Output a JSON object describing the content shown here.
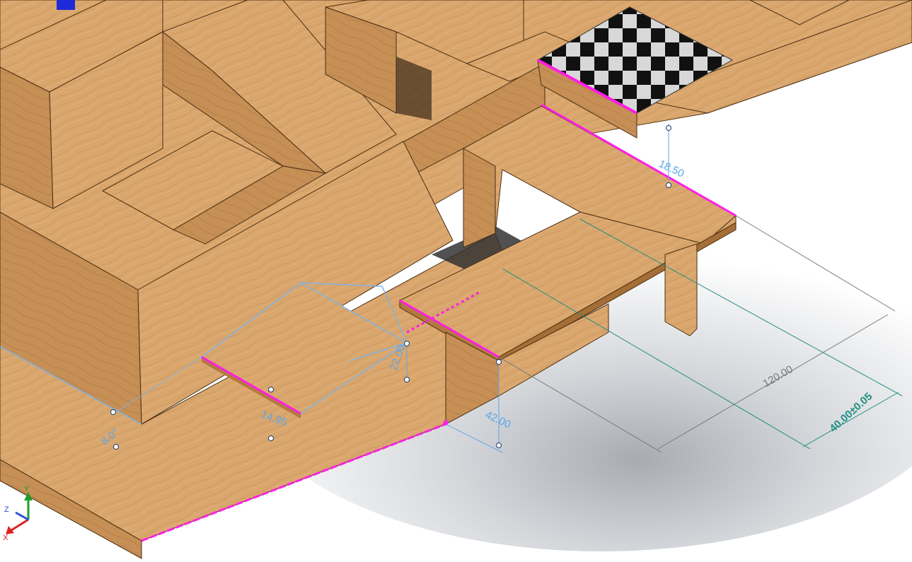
{
  "viewport": {
    "background_colors": {
      "top": "#ffffff",
      "shadow": "#bfc2c6"
    },
    "model": {
      "material": "beech-wood",
      "wood_color": "#d9a66d",
      "wood_dark": "#b88552"
    }
  },
  "dimensions": [
    {
      "id": "dim-18-50",
      "text": "18.50",
      "color": "#5aa5e8"
    },
    {
      "id": "dim-120",
      "text": "120.00",
      "color": "#7a7a7a"
    },
    {
      "id": "dim-40-tol",
      "text": "40.00±0.05",
      "color": "#1f8f84"
    },
    {
      "id": "dim-42",
      "text": "42.00",
      "color": "#5aa5e8"
    },
    {
      "id": "dim-22",
      "text": "22.00",
      "color": "#5aa5e8"
    },
    {
      "id": "dim-14-95",
      "text": "14.95",
      "color": "#5aa5e8"
    },
    {
      "id": "dim-8-0",
      "text": "8.0°",
      "color": "#5aa5e8"
    }
  ],
  "highlight_color": "#ff1ee6",
  "sketch_color": "#7fb4e6",
  "triad": {
    "axes": [
      {
        "name": "X",
        "color": "#e02020"
      },
      {
        "name": "Y",
        "color": "#1f9d2a"
      },
      {
        "name": "Z",
        "color": "#2a4fd8"
      }
    ]
  }
}
